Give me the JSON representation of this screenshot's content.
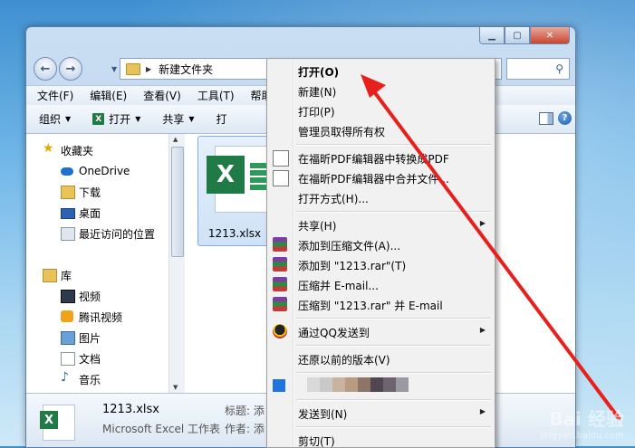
{
  "address": {
    "path": "新建文件夹"
  },
  "menubar": {
    "items": [
      "文件(F)",
      "编辑(E)",
      "查看(V)",
      "工具(T)",
      "帮助("
    ]
  },
  "toolbar": {
    "organize": "组织",
    "open": "打开",
    "share": "共享",
    "cut_label": "打"
  },
  "sidebar": {
    "favorites": "收藏夹",
    "onedrive": "OneDrive",
    "downloads": "下载",
    "desktop": "桌面",
    "recent": "最近访问的位置",
    "libraries": "库",
    "videos": "视频",
    "tencent_video": "腾讯视频",
    "pictures": "图片",
    "documents": "文档",
    "music": "音乐"
  },
  "file": {
    "name": "1213.xlsx"
  },
  "details": {
    "name": "1213.xlsx",
    "type": "Microsoft Excel 工作表",
    "k1": "标题: 添",
    "k2": "作者: 添"
  },
  "context_menu": {
    "open": "打开(O)",
    "new": "新建(N)",
    "print": "打印(P)",
    "take_ownership": "管理员取得所有权",
    "pdf_convert": "在福昕PDF编辑器中转换成PDF",
    "pdf_merge": "在福昕PDF编辑器中合并文件...",
    "open_with": "打开方式(H)...",
    "share": "共享(H)",
    "add_archive": "添加到压缩文件(A)...",
    "add_rar": "添加到 \"1213.rar\"(T)",
    "compress_email": "压缩并 E-mail...",
    "compress_rar_email": "压缩到 \"1213.rar\" 并 E-mail",
    "qq_send": "通过QQ发送到",
    "restore": "还原以前的版本(V)",
    "send_to": "发送到(N)",
    "cut": "剪切(T)"
  },
  "watermark": {
    "line1": "Bai 经验",
    "line2": "jingyan.baidu.com"
  },
  "colors": {
    "arrow": "#e8201c",
    "excel_green": "#1f7a45"
  }
}
